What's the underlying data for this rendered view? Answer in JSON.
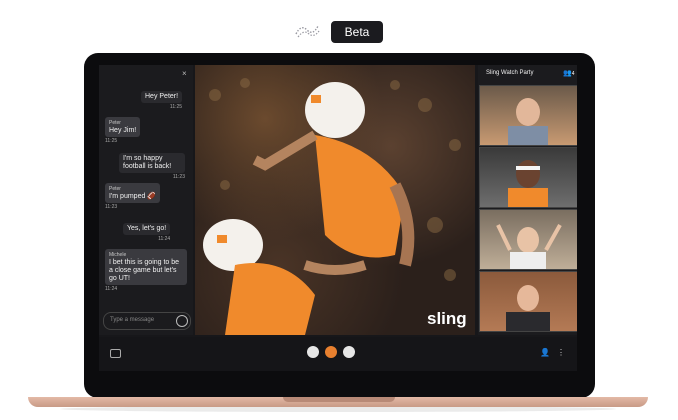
{
  "badge": {
    "label": "Beta"
  },
  "chat": {
    "close_label": "×",
    "messages": [
      {
        "sender": "",
        "text": "Hey Peter!",
        "time": "11:25",
        "mine": true
      },
      {
        "sender": "Peter",
        "text": "Hey Jim!",
        "time": "11:25",
        "mine": false
      },
      {
        "sender": "",
        "text": "I'm so happy football is back!",
        "time": "11:23",
        "mine": true
      },
      {
        "sender": "Peter",
        "text": "I'm pumped 🏈",
        "time": "11:23",
        "mine": false
      },
      {
        "sender": "",
        "text": "Yes, let's go!",
        "time": "11:24",
        "mine": true
      },
      {
        "sender": "Michele",
        "text": "I bet this is going to be a close game but let's go UT!",
        "time": "11:24",
        "mine": false
      }
    ],
    "input_placeholder": "Type a message"
  },
  "main": {
    "brand": "sling"
  },
  "side": {
    "title": "Sling Watch Party",
    "count": "4"
  },
  "colors": {
    "accent": "#e8802f",
    "laptop_base": "#d8ab96",
    "background": "#17171a"
  },
  "icons": {
    "emoji": "smiley-icon",
    "mic": "mic-icon",
    "end_call": "end-call-icon",
    "camera": "camera-icon",
    "chat": "chat-bubble-icon",
    "people": "people-icon",
    "more": "more-vertical-icon"
  }
}
